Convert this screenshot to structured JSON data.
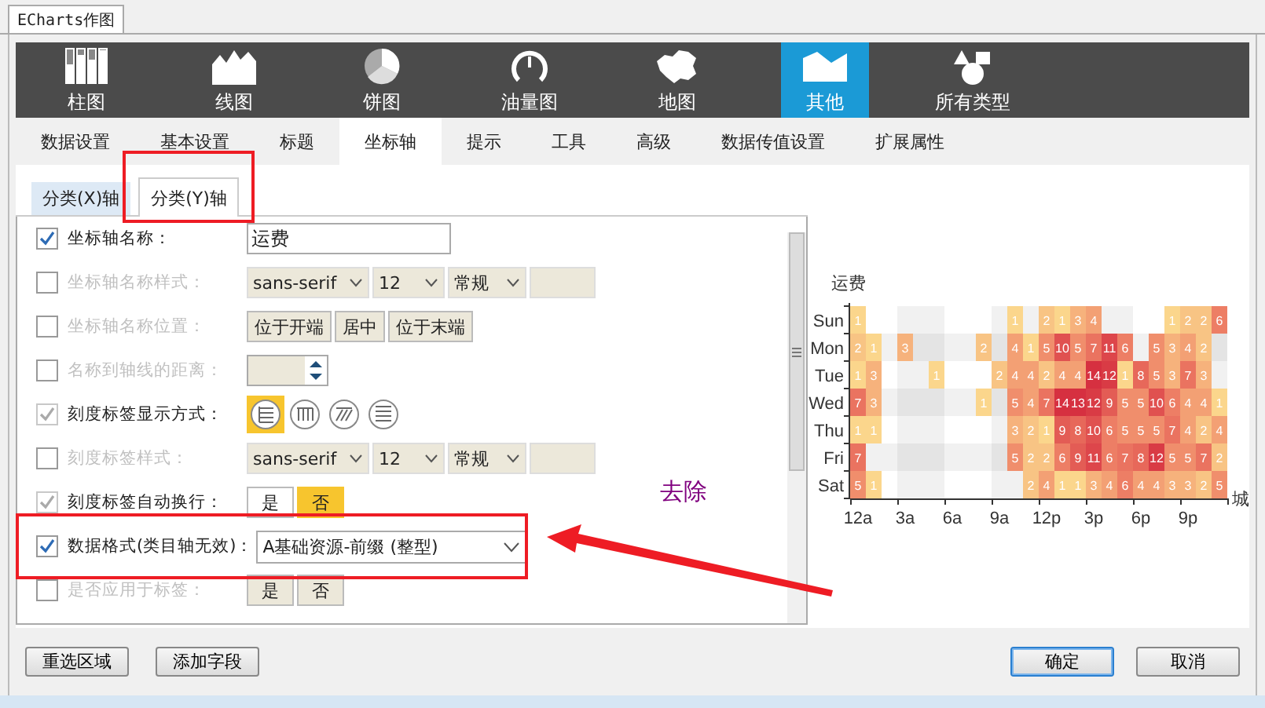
{
  "window_tab": "ECharts作图",
  "chart_types": [
    {
      "label": "柱图",
      "selected": false
    },
    {
      "label": "线图",
      "selected": false
    },
    {
      "label": "饼图",
      "selected": false
    },
    {
      "label": "油量图",
      "selected": false
    },
    {
      "label": "地图",
      "selected": false
    },
    {
      "label": "其他",
      "selected": true
    },
    {
      "label": "所有类型",
      "selected": false
    }
  ],
  "setting_tabs": [
    {
      "label": "数据设置",
      "selected": false
    },
    {
      "label": "基本设置",
      "selected": false
    },
    {
      "label": "标题",
      "selected": false
    },
    {
      "label": "坐标轴",
      "selected": true
    },
    {
      "label": "提示",
      "selected": false
    },
    {
      "label": "工具",
      "selected": false
    },
    {
      "label": "高级",
      "selected": false
    },
    {
      "label": "数据传值设置",
      "selected": false
    },
    {
      "label": "扩展属性",
      "selected": false
    }
  ],
  "axis_tabs": [
    {
      "label": "分类(X)轴",
      "selected": false
    },
    {
      "label": "分类(Y)轴",
      "selected": true
    }
  ],
  "form_rows": [
    {
      "kind": "text",
      "label": "坐标轴名称：",
      "checked": true,
      "disabled": false,
      "value": "运费"
    },
    {
      "kind": "font",
      "label": "坐标轴名称样式：",
      "checked": false,
      "disabled": false,
      "font": "sans-serif",
      "size": "12",
      "weight": "常规"
    },
    {
      "kind": "buttons",
      "label": "坐标轴名称位置：",
      "checked": false,
      "disabled": false,
      "options": [
        {
          "label": "位于开端",
          "selected": false
        },
        {
          "label": "居中",
          "selected": false
        },
        {
          "label": "位于末端",
          "selected": false
        }
      ]
    },
    {
      "kind": "spinner",
      "label": "名称到轴线的距离：",
      "checked": false,
      "disabled": false
    },
    {
      "kind": "icons",
      "label": "刻度标签显示方式：",
      "checked": true,
      "disabled": true,
      "options": [
        {
          "selected": true
        },
        {
          "selected": false
        },
        {
          "selected": false
        },
        {
          "selected": false
        }
      ]
    },
    {
      "kind": "font",
      "label": "刻度标签样式：",
      "checked": false,
      "disabled": false,
      "font": "sans-serif",
      "size": "12",
      "weight": "常规"
    },
    {
      "kind": "buttons",
      "label": "刻度标签自动换行：",
      "checked": true,
      "disabled": true,
      "options": [
        {
          "label": "是",
          "selected": false
        },
        {
          "label": "否",
          "selected": true
        }
      ]
    },
    {
      "kind": "dropdown",
      "label": "数据格式(类目轴无效)：",
      "checked": true,
      "disabled": false,
      "value": "A基础资源-前缀 (整型)"
    },
    {
      "kind": "buttons",
      "label": "是否应用于标签：",
      "checked": false,
      "disabled": false,
      "options": [
        {
          "label": "是",
          "selected": false
        },
        {
          "label": "否",
          "selected": false
        }
      ]
    }
  ],
  "heatmap": {
    "title": "运费",
    "axis_label": "城",
    "xticks": [
      "12a",
      "3a",
      "6a",
      "9a",
      "12p",
      "3p",
      "6p",
      "9p"
    ],
    "rows": [
      {
        "day": "Sun",
        "cells": [
          {
            "kind": "value",
            "value": "1"
          },
          {
            "kind": "blank"
          },
          {
            "kind": "blank"
          },
          {
            "kind": "blank"
          },
          {
            "kind": "blank"
          },
          {
            "kind": "blank"
          },
          {
            "kind": "blank"
          },
          {
            "kind": "blank"
          },
          {
            "kind": "blank"
          },
          {
            "kind": "blank"
          },
          {
            "kind": "value",
            "value": "1"
          },
          {
            "kind": "blank"
          },
          {
            "kind": "value",
            "value": "2"
          },
          {
            "kind": "value",
            "value": "1"
          },
          {
            "kind": "value",
            "value": "3"
          },
          {
            "kind": "value",
            "value": "4"
          },
          {
            "kind": "blank"
          },
          {
            "kind": "blank"
          },
          {
            "kind": "blank"
          },
          {
            "kind": "blank"
          },
          {
            "kind": "value",
            "value": "1"
          },
          {
            "kind": "value",
            "value": "2"
          },
          {
            "kind": "value",
            "value": "2"
          },
          {
            "kind": "value",
            "value": "6"
          }
        ]
      },
      {
        "day": "Mon",
        "cells": [
          {
            "kind": "value",
            "value": "2"
          },
          {
            "kind": "value",
            "value": "1"
          },
          {
            "kind": "blank"
          },
          {
            "kind": "value",
            "value": "3"
          },
          {
            "kind": "blank"
          },
          {
            "kind": "blank"
          },
          {
            "kind": "blank"
          },
          {
            "kind": "blank"
          },
          {
            "kind": "value",
            "value": "2"
          },
          {
            "kind": "blank"
          },
          {
            "kind": "value",
            "value": "4"
          },
          {
            "kind": "value",
            "value": "1"
          },
          {
            "kind": "value",
            "value": "5"
          },
          {
            "kind": "value",
            "value": "10"
          },
          {
            "kind": "value",
            "value": "5"
          },
          {
            "kind": "value",
            "value": "7"
          },
          {
            "kind": "value",
            "value": "11"
          },
          {
            "kind": "value",
            "value": "6"
          },
          {
            "kind": "blank"
          },
          {
            "kind": "value",
            "value": "5"
          },
          {
            "kind": "value",
            "value": "3"
          },
          {
            "kind": "value",
            "value": "4"
          },
          {
            "kind": "value",
            "value": "2"
          },
          {
            "kind": "blank"
          }
        ]
      },
      {
        "day": "Tue",
        "cells": [
          {
            "kind": "value",
            "value": "1"
          },
          {
            "kind": "value",
            "value": "3"
          },
          {
            "kind": "blank"
          },
          {
            "kind": "blank"
          },
          {
            "kind": "blank"
          },
          {
            "kind": "value",
            "value": "1"
          },
          {
            "kind": "blank"
          },
          {
            "kind": "blank"
          },
          {
            "kind": "blank"
          },
          {
            "kind": "value",
            "value": "2"
          },
          {
            "kind": "value",
            "value": "4"
          },
          {
            "kind": "value",
            "value": "4"
          },
          {
            "kind": "value",
            "value": "2"
          },
          {
            "kind": "value",
            "value": "4"
          },
          {
            "kind": "value",
            "value": "4"
          },
          {
            "kind": "value",
            "value": "14"
          },
          {
            "kind": "value",
            "value": "12"
          },
          {
            "kind": "value",
            "value": "1"
          },
          {
            "kind": "value",
            "value": "8"
          },
          {
            "kind": "value",
            "value": "5"
          },
          {
            "kind": "value",
            "value": "3"
          },
          {
            "kind": "value",
            "value": "7"
          },
          {
            "kind": "value",
            "value": "3"
          },
          {
            "kind": "blank"
          }
        ]
      },
      {
        "day": "Wed",
        "cells": [
          {
            "kind": "value",
            "value": "7"
          },
          {
            "kind": "value",
            "value": "3"
          },
          {
            "kind": "blank"
          },
          {
            "kind": "blank"
          },
          {
            "kind": "blank"
          },
          {
            "kind": "blank"
          },
          {
            "kind": "blank"
          },
          {
            "kind": "blank"
          },
          {
            "kind": "value",
            "value": "1"
          },
          {
            "kind": "blank"
          },
          {
            "kind": "value",
            "value": "5"
          },
          {
            "kind": "value",
            "value": "4"
          },
          {
            "kind": "value",
            "value": "7"
          },
          {
            "kind": "value",
            "value": "14"
          },
          {
            "kind": "value",
            "value": "13"
          },
          {
            "kind": "value",
            "value": "12"
          },
          {
            "kind": "value",
            "value": "9"
          },
          {
            "kind": "value",
            "value": "5"
          },
          {
            "kind": "value",
            "value": "5"
          },
          {
            "kind": "value",
            "value": "10"
          },
          {
            "kind": "value",
            "value": "6"
          },
          {
            "kind": "value",
            "value": "4"
          },
          {
            "kind": "value",
            "value": "4"
          },
          {
            "kind": "value",
            "value": "1"
          }
        ]
      },
      {
        "day": "Thu",
        "cells": [
          {
            "kind": "value",
            "value": "1"
          },
          {
            "kind": "value",
            "value": "1"
          },
          {
            "kind": "blank"
          },
          {
            "kind": "blank"
          },
          {
            "kind": "blank"
          },
          {
            "kind": "blank"
          },
          {
            "kind": "blank"
          },
          {
            "kind": "blank"
          },
          {
            "kind": "blank"
          },
          {
            "kind": "blank"
          },
          {
            "kind": "value",
            "value": "3"
          },
          {
            "kind": "value",
            "value": "2"
          },
          {
            "kind": "value",
            "value": "1"
          },
          {
            "kind": "value",
            "value": "9"
          },
          {
            "kind": "value",
            "value": "8"
          },
          {
            "kind": "value",
            "value": "10"
          },
          {
            "kind": "value",
            "value": "6"
          },
          {
            "kind": "value",
            "value": "5"
          },
          {
            "kind": "value",
            "value": "5"
          },
          {
            "kind": "value",
            "value": "5"
          },
          {
            "kind": "value",
            "value": "7"
          },
          {
            "kind": "value",
            "value": "4"
          },
          {
            "kind": "value",
            "value": "2"
          },
          {
            "kind": "value",
            "value": "4"
          }
        ]
      },
      {
        "day": "Fri",
        "cells": [
          {
            "kind": "value",
            "value": "7"
          },
          {
            "kind": "blank"
          },
          {
            "kind": "blank"
          },
          {
            "kind": "blank"
          },
          {
            "kind": "blank"
          },
          {
            "kind": "blank"
          },
          {
            "kind": "blank"
          },
          {
            "kind": "blank"
          },
          {
            "kind": "blank"
          },
          {
            "kind": "blank"
          },
          {
            "kind": "value",
            "value": "5"
          },
          {
            "kind": "value",
            "value": "2"
          },
          {
            "kind": "value",
            "value": "2"
          },
          {
            "kind": "value",
            "value": "6"
          },
          {
            "kind": "value",
            "value": "9"
          },
          {
            "kind": "value",
            "value": "11"
          },
          {
            "kind": "value",
            "value": "6"
          },
          {
            "kind": "value",
            "value": "7"
          },
          {
            "kind": "value",
            "value": "8"
          },
          {
            "kind": "value",
            "value": "12"
          },
          {
            "kind": "value",
            "value": "5"
          },
          {
            "kind": "value",
            "value": "5"
          },
          {
            "kind": "value",
            "value": "7"
          },
          {
            "kind": "value",
            "value": "2"
          }
        ]
      },
      {
        "day": "Sat",
        "cells": [
          {
            "kind": "value",
            "value": "5"
          },
          {
            "kind": "value",
            "value": "1"
          },
          {
            "kind": "blank"
          },
          {
            "kind": "blank"
          },
          {
            "kind": "blank"
          },
          {
            "kind": "blank"
          },
          {
            "kind": "blank"
          },
          {
            "kind": "blank"
          },
          {
            "kind": "blank"
          },
          {
            "kind": "blank"
          },
          {
            "kind": "blank"
          },
          {
            "kind": "value",
            "value": "2"
          },
          {
            "kind": "value",
            "value": "4"
          },
          {
            "kind": "value",
            "value": "1"
          },
          {
            "kind": "value",
            "value": "1"
          },
          {
            "kind": "value",
            "value": "3"
          },
          {
            "kind": "value",
            "value": "4"
          },
          {
            "kind": "value",
            "value": "6"
          },
          {
            "kind": "value",
            "value": "4"
          },
          {
            "kind": "value",
            "value": "4"
          },
          {
            "kind": "value",
            "value": "3"
          },
          {
            "kind": "value",
            "value": "3"
          },
          {
            "kind": "value",
            "value": "2"
          },
          {
            "kind": "value",
            "value": "5"
          }
        ]
      }
    ]
  },
  "annotation": {
    "text": "去除"
  },
  "footer_buttons": [
    {
      "label": "重选区域",
      "primary": false
    },
    {
      "label": "添加字段",
      "primary": false
    },
    {
      "label": "确定",
      "primary": true
    },
    {
      "label": "取消",
      "primary": false
    }
  ]
}
